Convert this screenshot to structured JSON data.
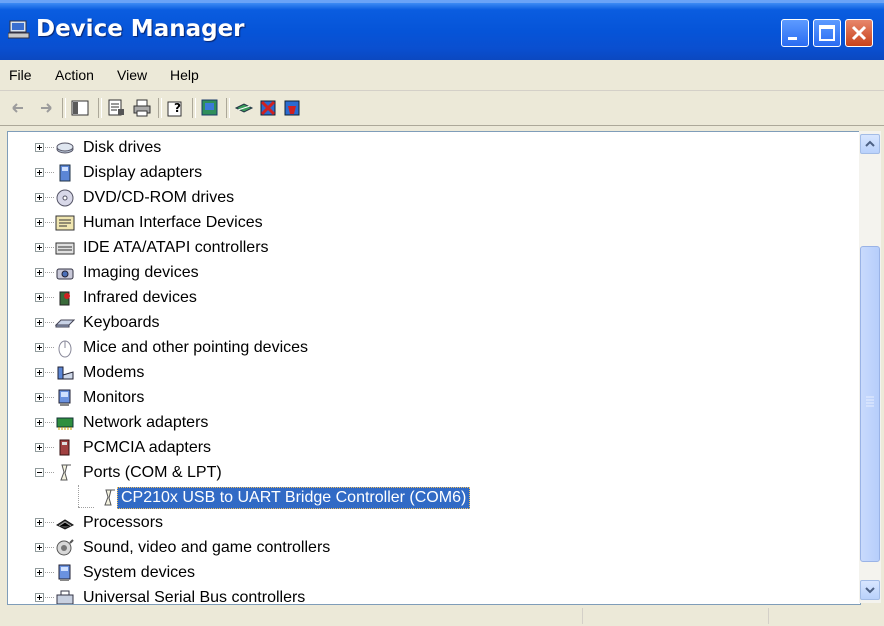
{
  "window": {
    "title": "Device Manager"
  },
  "menu": [
    "File",
    "Action",
    "View",
    "Help"
  ],
  "toolbar": [
    "back-icon",
    "forward-icon",
    "show-hide-console-tree-icon",
    "properties-icon",
    "print-icon",
    "help-icon",
    "update-driver-icon",
    "scan-hardware-icon",
    "disable-device-icon",
    "uninstall-device-icon"
  ],
  "tree": {
    "items": [
      {
        "label": "Disk drives",
        "icon": "disk-drive-icon"
      },
      {
        "label": "Display adapters",
        "icon": "display-adapter-icon"
      },
      {
        "label": "DVD/CD-ROM drives",
        "icon": "dvd-drive-icon"
      },
      {
        "label": "Human Interface Devices",
        "icon": "hid-icon"
      },
      {
        "label": "IDE ATA/ATAPI controllers",
        "icon": "ide-controller-icon"
      },
      {
        "label": "Imaging devices",
        "icon": "camera-icon"
      },
      {
        "label": "Infrared devices",
        "icon": "infrared-icon"
      },
      {
        "label": "Keyboards",
        "icon": "keyboard-icon"
      },
      {
        "label": "Mice and other pointing devices",
        "icon": "mouse-icon"
      },
      {
        "label": "Modems",
        "icon": "modem-icon"
      },
      {
        "label": "Monitors",
        "icon": "monitor-icon"
      },
      {
        "label": "Network adapters",
        "icon": "network-adapter-icon"
      },
      {
        "label": "PCMCIA adapters",
        "icon": "pcmcia-icon"
      },
      {
        "label": "Ports (COM & LPT)",
        "icon": "port-icon",
        "expanded": true
      },
      {
        "label": "CP210x USB to UART Bridge Controller (COM6)",
        "icon": "port-icon",
        "child": true,
        "selected": true
      },
      {
        "label": "Processors",
        "icon": "processor-icon"
      },
      {
        "label": "Sound, video and game controllers",
        "icon": "sound-icon"
      },
      {
        "label": "System devices",
        "icon": "system-device-icon"
      },
      {
        "label": "Universal Serial Bus controllers",
        "icon": "usb-icon"
      }
    ]
  },
  "colors": {
    "selection": "#316ac5",
    "titlebar": "#0a5de0"
  }
}
